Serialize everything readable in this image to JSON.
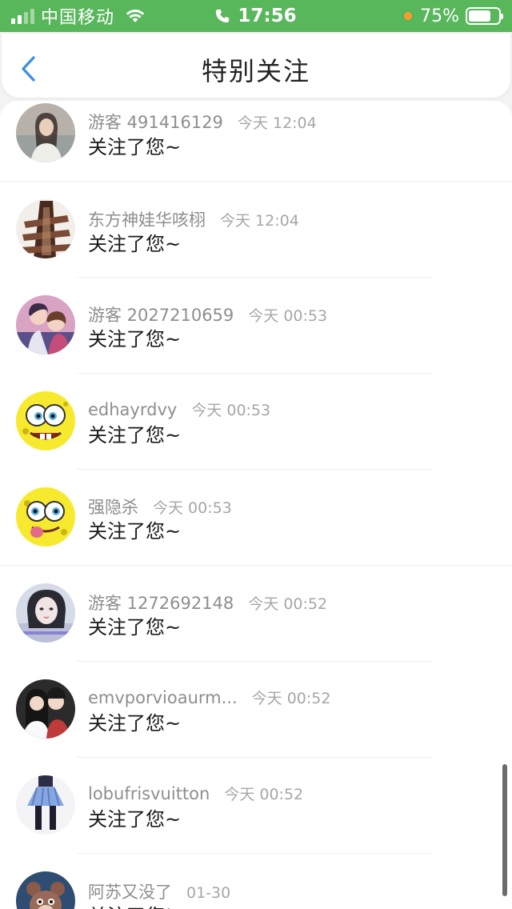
{
  "status_bar": {
    "carrier": "中国移动",
    "time": "17:56",
    "battery": "75%",
    "battery_level": 0.75,
    "colors": {
      "background": "#58b65b",
      "charging_dot": "#ff9a2e"
    }
  },
  "nav": {
    "title": "特别关注",
    "back_icon": "chevron-left-icon",
    "accent": "#3a8de8"
  },
  "rows": [
    {
      "name": "游客 491416129",
      "time": "今天 12:04",
      "message": "关注了您~"
    },
    {
      "name": "东方神娃华咳栩",
      "time": "今天 12:04",
      "message": "关注了您~"
    },
    {
      "name": "游客 2027210659",
      "time": "今天 00:53",
      "message": "关注了您~"
    },
    {
      "name": "edhayrdvy",
      "time": "今天 00:53",
      "message": "关注了您~"
    },
    {
      "name": "强隐杀",
      "time": "今天 00:53",
      "message": "关注了您~"
    },
    {
      "name": "游客 1272692148",
      "time": "今天 00:52",
      "message": "关注了您~"
    },
    {
      "name": "emvporvioaurm...",
      "time": "今天 00:52",
      "message": "关注了您~"
    },
    {
      "name": "lobufrisvuitton",
      "time": "今天 00:52",
      "message": "关注了您~"
    },
    {
      "name": "阿苏又没了",
      "time": "01-30",
      "message": "关注了您!"
    }
  ]
}
